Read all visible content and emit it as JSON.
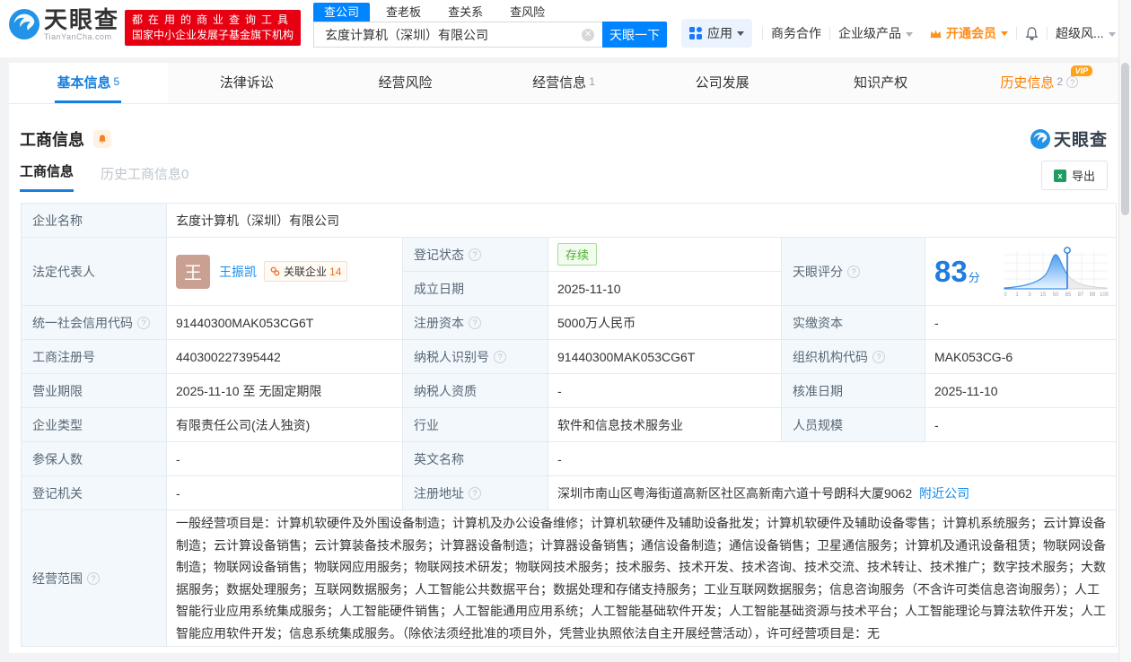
{
  "header": {
    "logo_title": "天眼查",
    "logo_domain": "TianYanCha.com",
    "slogan_line1": "都在用的商业查询工具",
    "slogan_line2": "国家中小企业发展子基金旗下机构",
    "search_tab_company": "查公司",
    "search_tab_boss": "查老板",
    "search_tab_relation": "查关系",
    "search_tab_risk": "查风险",
    "search_value": "玄度计算机（深圳）有限公司",
    "search_button": "天眼一下",
    "menu_apps": "应用",
    "menu_cooperation": "商务合作",
    "menu_enterprise": "企业级产品",
    "menu_vip": "开通会员",
    "menu_super_risk": "超级风..."
  },
  "nav": {
    "basic": "基本信息",
    "basic_count": "5",
    "legal": "法律诉讼",
    "risk": "经营风险",
    "operation": "经营信息",
    "operation_count": "1",
    "development": "公司发展",
    "ip": "知识产权",
    "history": "历史信息",
    "history_count": "2",
    "history_vip": "VIP"
  },
  "section": {
    "title": "工商信息",
    "watermark": "天眼查",
    "tab_current": "工商信息",
    "tab_history": "历史工商信息0",
    "export": "导出"
  },
  "table": {
    "company_name_label": "企业名称",
    "company_name": "玄度计算机（深圳）有限公司",
    "legal_rep_label": "法定代表人",
    "legal_rep_avatar": "王",
    "legal_rep_name": "王振凯",
    "related_label": "关联企业",
    "related_count": "14",
    "reg_status_label": "登记状态",
    "reg_status": "存续",
    "establish_label": "成立日期",
    "establish_date": "2025-11-10",
    "score_label": "天眼评分",
    "score": "83",
    "score_unit": "分",
    "score_axis": [
      "0",
      "1",
      "3",
      "15",
      "50",
      "85",
      "97",
      "99",
      "100"
    ],
    "credit_code_label": "统一社会信用代码",
    "credit_code": "91440300MAK053CG6T",
    "reg_capital_label": "注册资本",
    "reg_capital": "5000万人民币",
    "paid_capital_label": "实缴资本",
    "paid_capital": "-",
    "reg_number_label": "工商注册号",
    "reg_number": "440300227395442",
    "taxpayer_id_label": "纳税人识别号",
    "taxpayer_id": "91440300MAK053CG6T",
    "org_code_label": "组织机构代码",
    "org_code": "MAK053CG-6",
    "business_term_label": "营业期限",
    "business_term": "2025-11-10 至 无固定期限",
    "taxpayer_quality_label": "纳税人资质",
    "taxpayer_quality": "-",
    "approval_date_label": "核准日期",
    "approval_date": "2025-11-10",
    "company_type_label": "企业类型",
    "company_type": "有限责任公司(法人独资)",
    "industry_label": "行业",
    "industry": "软件和信息技术服务业",
    "staff_size_label": "人员规模",
    "staff_size": "-",
    "insured_label": "参保人数",
    "insured": "-",
    "english_name_label": "英文名称",
    "english_name": "-",
    "reg_authority_label": "登记机关",
    "reg_authority": "-",
    "address_label": "注册地址",
    "address": "深圳市南山区粤海街道高新区社区高新南六道十号朗科大厦9062",
    "address_link": "附近公司",
    "scope_label": "经营范围",
    "scope": "一般经营项目是：计算机软硬件及外围设备制造；计算机及办公设备维修；计算机软硬件及辅助设备批发；计算机软硬件及辅助设备零售；计算机系统服务；云计算设备制造；云计算设备销售；云计算装备技术服务；计算器设备制造；计算器设备销售；通信设备制造；通信设备销售；卫星通信服务；计算机及通讯设备租赁；物联网设备制造；物联网设备销售；物联网应用服务；物联网技术研发；物联网技术服务；技术服务、技术开发、技术咨询、技术交流、技术转让、技术推广；数字技术服务；大数据服务；数据处理服务；互联网数据服务；人工智能公共数据平台；数据处理和存储支持服务；工业互联网数据服务；信息咨询服务（不含许可类信息咨询服务）；人工智能行业应用系统集成服务；人工智能硬件销售；人工智能通用应用系统；人工智能基础软件开发；人工智能基础资源与技术平台；人工智能理论与算法软件开发；人工智能应用软件开发；信息系统集成服务。（除依法须经批准的项目外，凭营业执照依法自主开展经营活动），许可经营项目是：无"
  }
}
